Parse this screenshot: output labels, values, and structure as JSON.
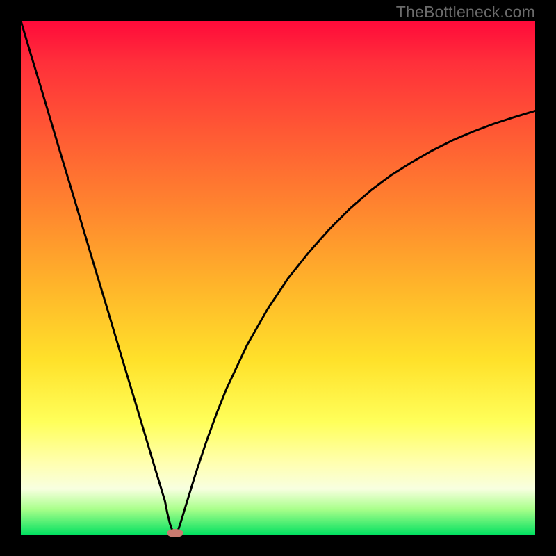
{
  "watermark": "TheBottleneck.com",
  "chart_data": {
    "type": "line",
    "title": "",
    "xlabel": "",
    "ylabel": "",
    "xlim": [
      0,
      100
    ],
    "ylim": [
      0,
      100
    ],
    "series": [
      {
        "name": "bottleneck-curve",
        "x": [
          0,
          2,
          4,
          6,
          8,
          10,
          12,
          14,
          16,
          18,
          20,
          22,
          24,
          26,
          28,
          28.5,
          29,
          29.5,
          30,
          30.5,
          31,
          32,
          34,
          36,
          38,
          40,
          44,
          48,
          52,
          56,
          60,
          64,
          68,
          72,
          76,
          80,
          84,
          88,
          92,
          96,
          100
        ],
        "y": [
          100,
          93.3,
          86.7,
          80,
          73.3,
          66.7,
          60,
          53.3,
          46.7,
          40,
          33.3,
          26.7,
          20,
          13.3,
          6.7,
          4.2,
          2.2,
          0.8,
          0,
          0.8,
          2.2,
          5.5,
          12,
          18,
          23.5,
          28.5,
          37,
          44,
          50,
          55,
          59.5,
          63.5,
          67,
          70,
          72.5,
          74.8,
          76.8,
          78.5,
          80,
          81.3,
          82.5
        ]
      }
    ],
    "marker": {
      "x": 30,
      "y": 0,
      "color": "#c97a6f"
    },
    "background_gradient": {
      "top": "#ff0a3a",
      "mid": "#ffe12a",
      "bottom": "#00e060"
    }
  }
}
